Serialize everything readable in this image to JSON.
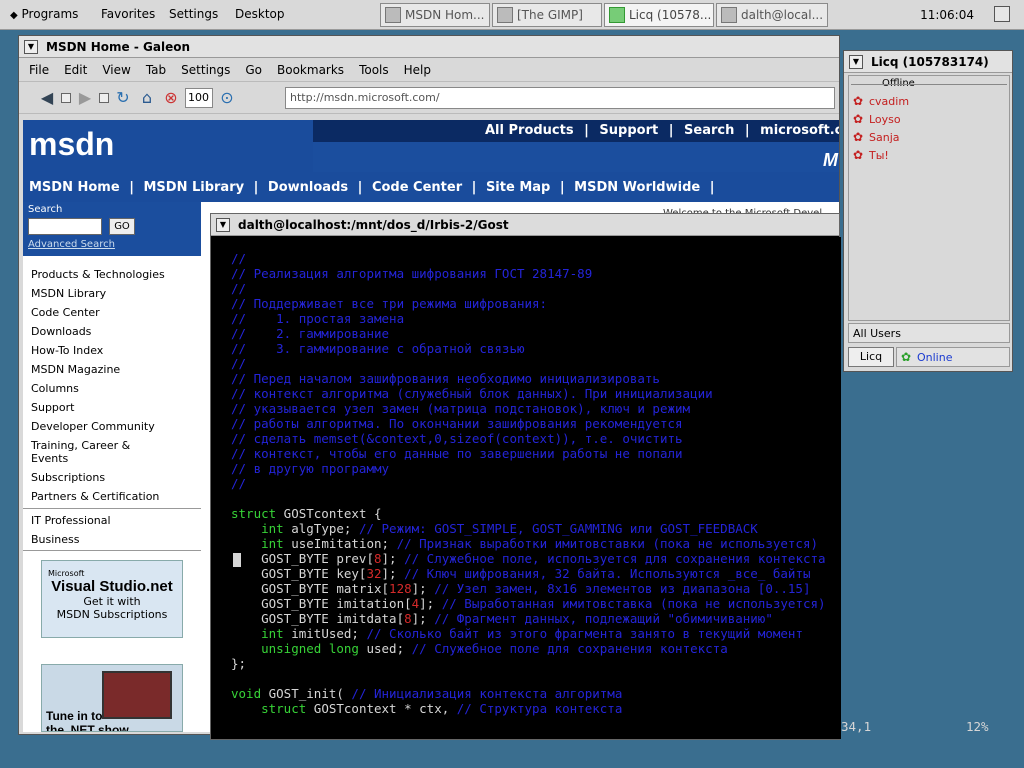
{
  "taskbar": {
    "menus": [
      "Programs",
      "Favorites",
      "Settings",
      "Desktop"
    ],
    "tasks": [
      "MSDN Hom...",
      "[The GIMP]",
      "Licq (10578...",
      "dalth@local..."
    ],
    "clock": "11:06:04"
  },
  "galeon": {
    "title": "MSDN Home - Galeon",
    "menu": [
      "File",
      "Edit",
      "View",
      "Tab",
      "Settings",
      "Go",
      "Bookmarks",
      "Tools",
      "Help"
    ],
    "zoom": "100",
    "url": "http://msdn.microsoft.com/"
  },
  "msdn": {
    "logo": "msdn",
    "top_nav": [
      "All Products",
      "|",
      "Support",
      "|",
      "Search",
      "|",
      "microsoft.c"
    ],
    "top_tag": "M",
    "nav": [
      "MSDN Home",
      "|",
      "MSDN Library",
      "|",
      "Downloads",
      "|",
      "Code Center",
      "|",
      "Site Map",
      "|",
      "MSDN Worldwide",
      "|"
    ],
    "welcome": "Welcome to the Microsoft Devel",
    "search_label": "Search",
    "go_label": "GO",
    "advanced_search": "Advanced Search",
    "links": [
      "Products & Technologies",
      "MSDN Library",
      "Code Center",
      "Downloads",
      "How-To Index",
      "MSDN Magazine",
      "Columns",
      "Support",
      "Developer Community",
      "Training, Career &",
      "Events",
      "Subscriptions",
      "Partners & Certification"
    ],
    "links2": [
      "IT Professional",
      "Business"
    ],
    "ad1_brand": "Microsoft",
    "ad1_title": "Visual Studio.net",
    "ad1_line1": "Get it with",
    "ad1_line2": "MSDN Subscriptions",
    "ad2_text": "Tune in to",
    "ad2_text2": "the .NET show"
  },
  "terminal": {
    "title": "dalth@localhost:/mnt/dos_d/Irbis-2/Gost",
    "lines": [
      "//",
      "// Реализация алгоритма шифрования ГОСТ 28147-89",
      "//",
      "// Поддерживает все три режима шифрования:",
      "//    1. простая замена",
      "//    2. гаммирование",
      "//    3. гаммирование с обратной связью",
      "//",
      "// Перед началом зашифрования необходимо инициализировать",
      "// контекст алгоритма (служебный блок данных). При инициализации",
      "// указывается узел замен (матрица подстановок), ключ и режим",
      "// работы алгоритма. По окончании зашифрования рекомендуется",
      "// сделать memset(&context,0,sizeof(context)), т.е. очистить",
      "// контекст, чтобы его данные по завершении работы не попали",
      "// в другую программу",
      "//",
      "",
      "struct|GOSTcontext {",
      "    int|algType; |// Режим: GOST_SIMPLE, GOST_GAMMING или GOST_FEEDBACK",
      "    int|useImitation; |// Признак выработки имитовставки (пока не используется)",
      "    GOST_BYTE prev[|8|]; |// Служебное поле, используется для сохранения контекста",
      "    GOST_BYTE key[|32|]; |// Ключ шифрования, 32 байта. Используются _все_ байты",
      "    GOST_BYTE matrix[|128|]; |// Узел замен, 8x16 элементов из диапазона [0..15]",
      "    GOST_BYTE imitation[|4|]; |// Выработанная имитовставка (пока не используется)",
      "    GOST_BYTE imitdata[|8|]; |// Фрагмент данных, подлежащий \"обимичиванию\"",
      "    int|imitUsed; |// Сколько байт из этого фрагмента занято в текущий момент",
      "    unsigned long|used; |// Служебное поле для сохранения контекста",
      "};",
      "",
      "void|GOST_init( |// Инициализация контекста алгоритма",
      "    struct|GOSTcontext * ctx, |// Структура контекста"
    ],
    "status_pos": "34,1",
    "status_pct": "12%"
  },
  "licq": {
    "title": "Licq (105783174)",
    "group": "Offline",
    "contacts": [
      "cvadim",
      "Loyso",
      "Sanja",
      "Ты!"
    ],
    "all_users": "All Users",
    "button": "Licq",
    "status": "Online"
  }
}
